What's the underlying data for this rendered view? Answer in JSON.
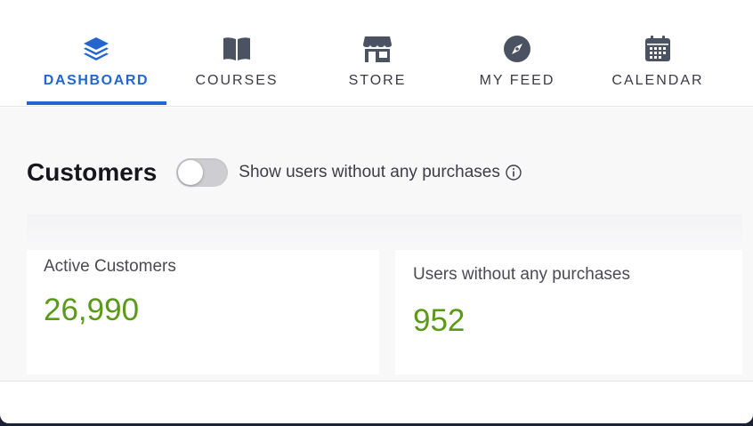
{
  "nav": {
    "items": [
      {
        "label": "DASHBOARD",
        "icon": "layers-icon",
        "active": true
      },
      {
        "label": "COURSES",
        "icon": "book-icon",
        "active": false
      },
      {
        "label": "STORE",
        "icon": "store-icon",
        "active": false
      },
      {
        "label": "MY FEED",
        "icon": "compass-icon",
        "active": false
      },
      {
        "label": "CALENDAR",
        "icon": "calendar-icon",
        "active": false
      }
    ],
    "active_color": "#2366cf",
    "icon_color": "#4b5363"
  },
  "customers": {
    "title": "Customers",
    "toggle_label": "Show users without any purchases",
    "toggle_on": false
  },
  "stats": {
    "active_label": "Active Customers",
    "active_value": "26,990",
    "no_purchase_label": "Users without any purchases",
    "no_purchase_value": "952",
    "value_color": "#5a9a18"
  }
}
